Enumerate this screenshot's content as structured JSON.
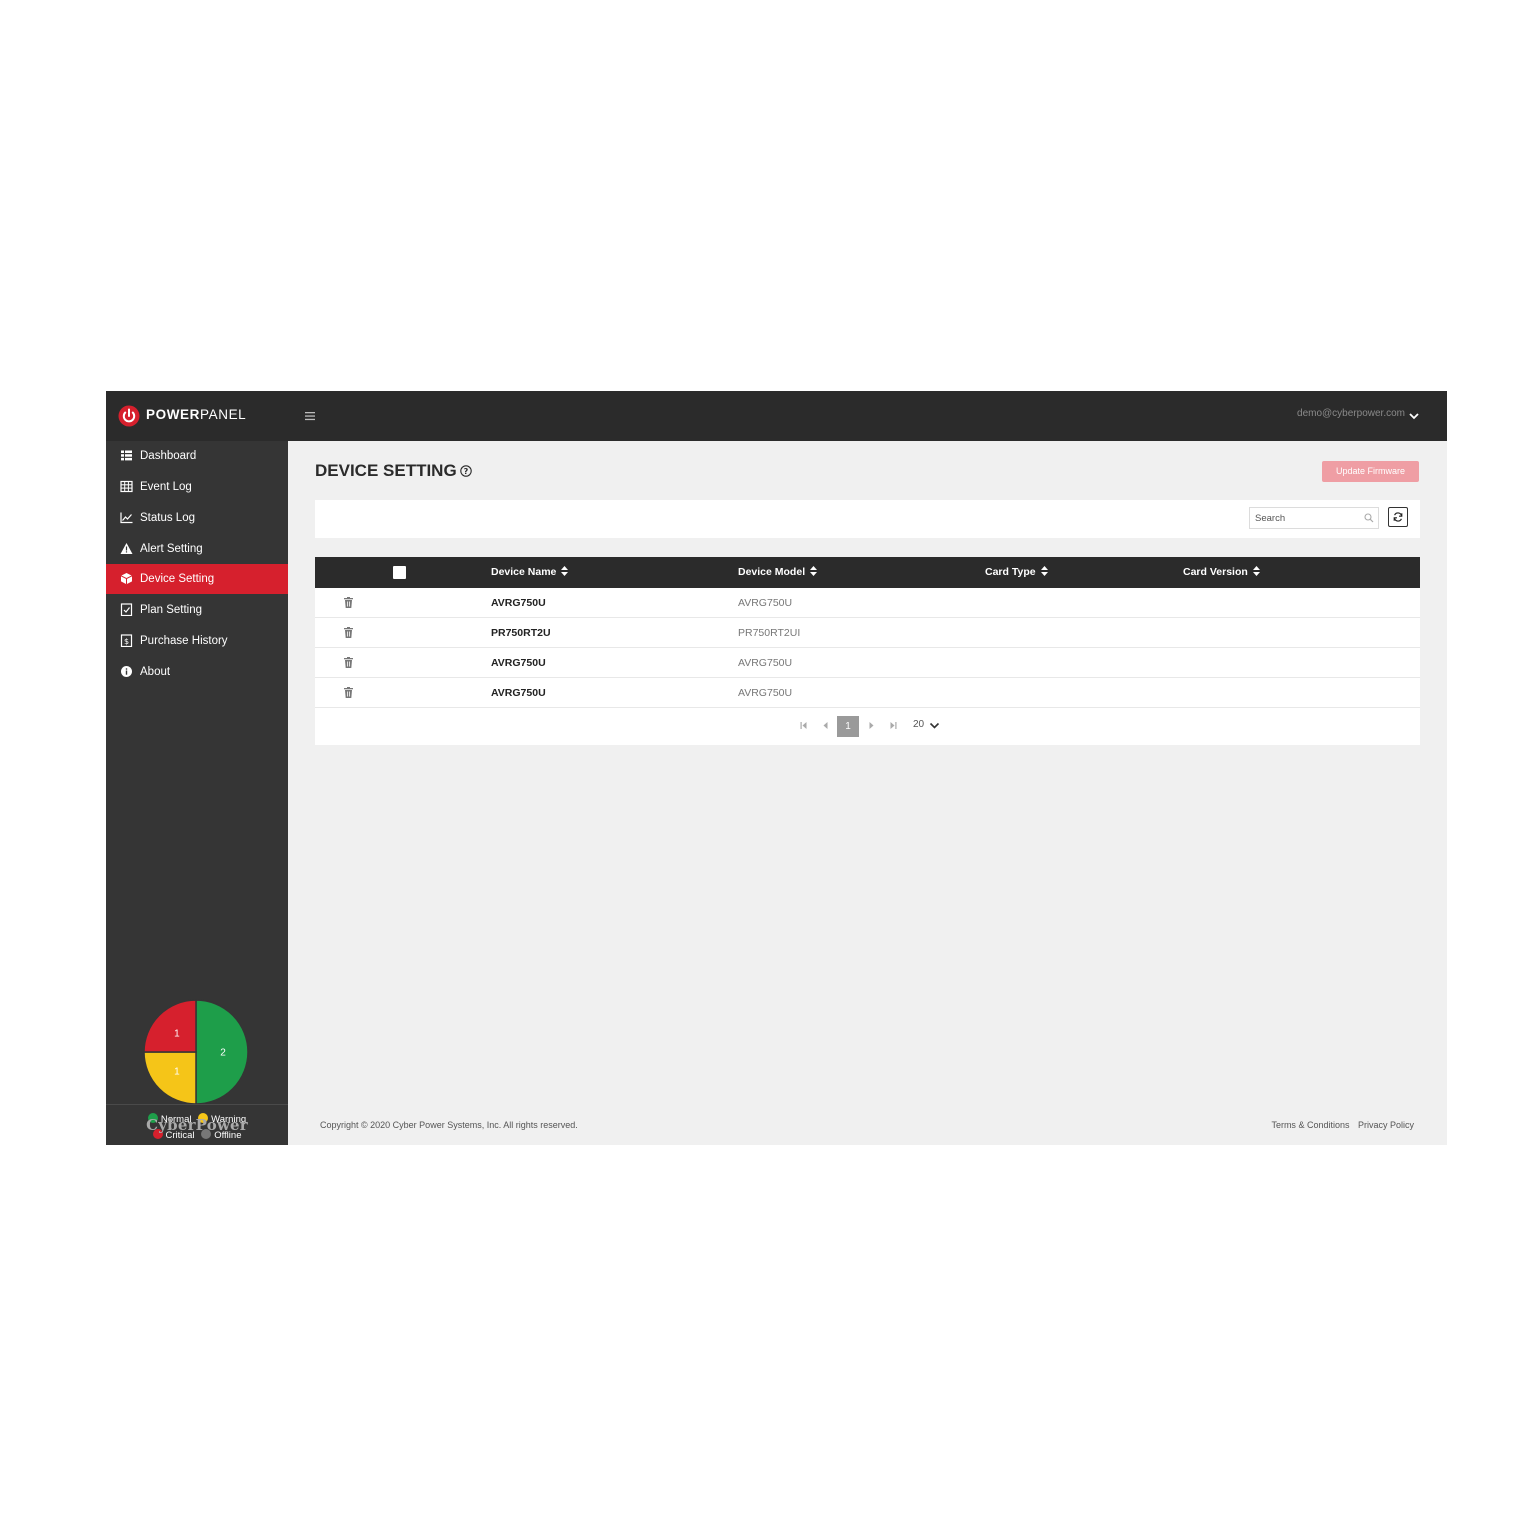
{
  "app": {
    "brand_bold": "POWER",
    "brand_light": "PANEL",
    "user_email": "demo@cyberpower.com"
  },
  "sidebar": {
    "items": [
      {
        "label": "Dashboard",
        "icon": "dashboard-grid-icon"
      },
      {
        "label": "Event Log",
        "icon": "table-icon"
      },
      {
        "label": "Status Log",
        "icon": "line-chart-icon"
      },
      {
        "label": "Alert Setting",
        "icon": "warning-icon"
      },
      {
        "label": "Device Setting",
        "icon": "cube-icon",
        "active": true
      },
      {
        "label": "Plan Setting",
        "icon": "clipboard-icon"
      },
      {
        "label": "Purchase History",
        "icon": "receipt-icon"
      },
      {
        "label": "About",
        "icon": "info-icon"
      }
    ],
    "status_chart": {
      "slices": [
        {
          "label": "Normal",
          "value": 2,
          "color": "#1e9e4a"
        },
        {
          "label": "Warning",
          "value": 1,
          "color": "#f5c518"
        },
        {
          "label": "Critical",
          "value": 1,
          "color": "#d6202d"
        },
        {
          "label": "Offline",
          "value": 0,
          "color": "#777777"
        }
      ]
    },
    "footer_logo": "CyberPower"
  },
  "page": {
    "title": "DEVICE SETTING",
    "update_button": "Update Firmware",
    "search_placeholder": "Search"
  },
  "table": {
    "columns": [
      "Device Name",
      "Device Model",
      "Card Type",
      "Card Version"
    ],
    "rows": [
      {
        "name": "AVRG750U",
        "model": "AVRG750U"
      },
      {
        "name": "PR750RT2U",
        "model": "PR750RT2UI"
      },
      {
        "name": "AVRG750U",
        "model": "AVRG750U"
      },
      {
        "name": "AVRG750U",
        "model": "AVRG750U"
      }
    ]
  },
  "pagination": {
    "current_page": "1",
    "page_size": "20"
  },
  "footer": {
    "copyright": "Copyright © 2020 Cyber Power Systems, Inc. All rights reserved.",
    "terms": "Terms & Conditions",
    "privacy": "Privacy Policy"
  },
  "colors": {
    "accent": "#d6202d",
    "topbar": "#2b2b2b",
    "sidebar": "#353535"
  }
}
